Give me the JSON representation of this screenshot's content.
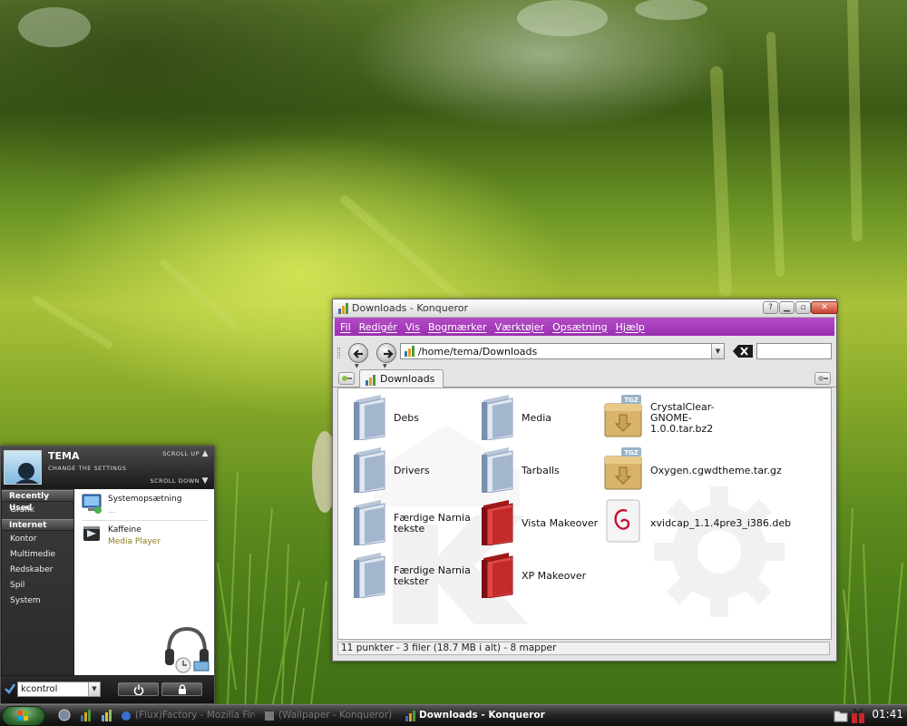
{
  "konqueror": {
    "title": "Downloads - Konqueror",
    "menu": [
      "Fil",
      "Redigér",
      "Vis",
      "Bogmærker",
      "Værktøjer",
      "Opsætning",
      "Hjælp"
    ],
    "location": "/home/tema/Downloads",
    "tab_label": "Downloads",
    "items": [
      {
        "label": "Debs",
        "type": "folder"
      },
      {
        "label": "Drivers",
        "type": "folder"
      },
      {
        "label": "Færdige Narnia tekste",
        "type": "folder"
      },
      {
        "label": "Færdige Narnia tekster",
        "type": "folder"
      },
      {
        "label": "Media",
        "type": "folder"
      },
      {
        "label": "Tarballs",
        "type": "folder"
      },
      {
        "label": "Vista Makeover",
        "type": "red-folder"
      },
      {
        "label": "XP Makeover",
        "type": "red-folder"
      },
      {
        "label": "CrystalClear-GNOME-1.0.0.tar.bz2",
        "type": "tarball",
        "badge": "TGZ"
      },
      {
        "label": "Oxygen.cgwdtheme.tar.gz",
        "type": "tarball",
        "badge": "TGZ"
      },
      {
        "label": "xvidcap_1.1.4pre3_i386.deb",
        "type": "deb"
      }
    ],
    "status": "11 punkter - 3 filer (18.7 MB i alt) - 8 mapper"
  },
  "startmenu": {
    "user": "TEMA",
    "change_settings": "CHANGE THE SETTINGS",
    "scroll_up": "SCROLL UP",
    "scroll_down": "SCROLL DOWN",
    "categories": [
      {
        "label": "Recently Used",
        "header": true
      },
      {
        "label": "Grafik",
        "header": false
      },
      {
        "label": "Internet",
        "header": true
      },
      {
        "label": "Kontor",
        "header": false
      },
      {
        "label": "Multimedie",
        "header": false
      },
      {
        "label": "Redskaber",
        "header": false
      },
      {
        "label": "Spil",
        "header": false
      },
      {
        "label": "System",
        "header": false
      }
    ],
    "apps": [
      {
        "name": "Systemopsætning",
        "desc": "..."
      },
      {
        "name": "Kaffeine",
        "desc": "Media Player"
      }
    ],
    "run_value": "kcontrol"
  },
  "taskbar": {
    "tasks": [
      {
        "label": "(Flux)Factory - Mozilla Firefox",
        "active": false
      },
      {
        "label": "(Wallpaper - Konqueror)",
        "active": false
      },
      {
        "label": "Downloads - Konqueror",
        "active": true
      }
    ],
    "clock": "01:41"
  },
  "colors": {
    "menubar": "#a43cba",
    "red_folder": "#d42a2a",
    "start_orb": "#2f6b2f"
  }
}
